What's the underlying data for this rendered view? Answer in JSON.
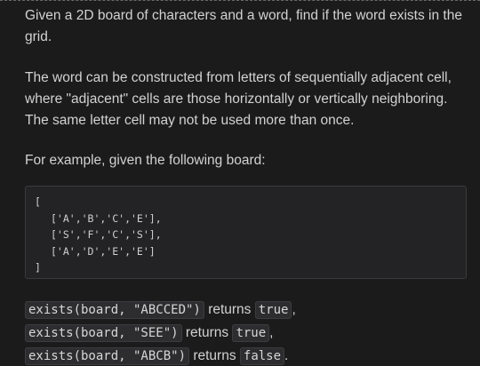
{
  "description": {
    "paragraph1": "Given a 2D board of characters and a word, find if the word exists in the grid.",
    "paragraph2": "The word can be constructed from letters of sequentially adjacent cell, where \"adjacent\" cells are those horizontally or vertically neighboring. The same letter cell may not be used more than once.",
    "paragraph3": "For example, given the following board:"
  },
  "board": {
    "open": "[",
    "rows": [
      "['A','B','C','E'],",
      "['S','F','C','S'],",
      "['A','D','E','E']"
    ],
    "close": "]"
  },
  "examples": [
    {
      "call": "exists(board, \"ABCCED\")",
      "returns_label": "returns",
      "result": "true",
      "punct": ","
    },
    {
      "call": "exists(board, \"SEE\")",
      "returns_label": "returns",
      "result": "true",
      "punct": ","
    },
    {
      "call": "exists(board, \"ABCB\")",
      "returns_label": "returns",
      "result": "false",
      "punct": "."
    }
  ]
}
